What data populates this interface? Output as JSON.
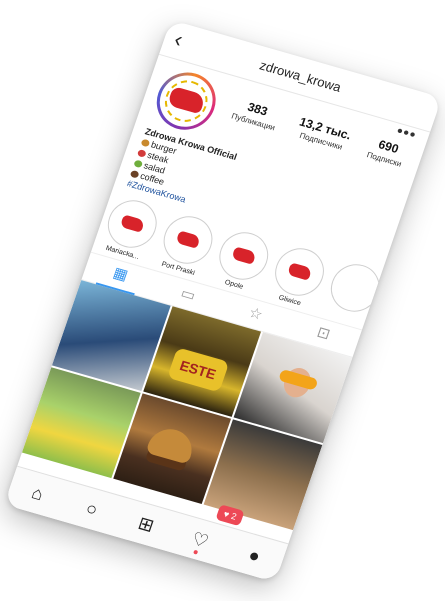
{
  "header": {
    "back_icon": "chevron-left-icon",
    "title": "zdrowa_krowa",
    "more_icon": "more-dots-icon",
    "more_label": "•••"
  },
  "profile": {
    "stats": [
      {
        "value": "383",
        "label": "Публикации"
      },
      {
        "value": "13,2 тыс.",
        "label": "Подписчики"
      },
      {
        "value": "690",
        "label": "Подписки"
      }
    ],
    "name": "Zdrowa Krowa Official",
    "bio_lines": [
      "burger",
      "steak",
      "salad",
      "coffee"
    ],
    "hashtag": "#ZdrowaKrowa"
  },
  "stories": [
    {
      "label": "Mariacka..."
    },
    {
      "label": "Port Praski"
    },
    {
      "label": "Opole"
    },
    {
      "label": "Gliwice"
    },
    {
      "label": ""
    }
  ],
  "tabs": {
    "grid": "▦",
    "feed": "▭",
    "star": "☆",
    "tagged": "⊡"
  },
  "posts": {
    "sign_text": "ESTE"
  },
  "notification": {
    "count": "2",
    "heart": "♥"
  },
  "nav": {
    "home": "⌂",
    "search": "○",
    "add": "⊞",
    "heart": "♡",
    "profile": "●"
  },
  "colors": {
    "accent_red": "#d8232a",
    "link_blue": "#1b4f9c",
    "tab_active": "#3897f0",
    "notif_red": "#ed4956"
  }
}
